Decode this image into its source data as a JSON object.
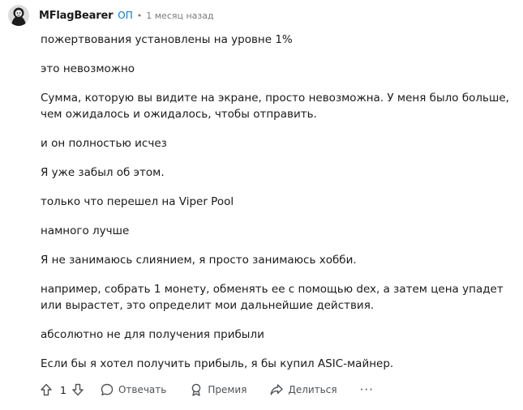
{
  "comment": {
    "author": "MFlagBearer",
    "op_badge": "ОП",
    "separator": "•",
    "timestamp": "1 месяц назад",
    "paragraphs": [
      "пожертвования установлены на уровне 1%",
      "это невозможно",
      "Сумма, которую вы видите на экране, просто невозможна. У меня было больше, чем ожидалось и ожидалось, чтобы отправить.",
      "и он полностью исчез",
      "Я уже забыл об этом.",
      "только что перешел на Viper Pool",
      "намного лучше",
      "Я не занимаюсь слиянием, я просто занимаюсь хобби.",
      "например, собрать 1 монету, обменять ее с помощью dex, а затем цена упадет или вырастет, это определит мои дальнейшие действия.",
      "абсолютно не для получения прибыли",
      "Если бы я хотел получить прибыль, я бы купил ASIC-майнер."
    ]
  },
  "actions": {
    "upvote_icon": "arrow-up-icon",
    "vote_count": "1",
    "downvote_icon": "arrow-down-icon",
    "reply_icon": "comment-bubble-icon",
    "reply_label": "Отвечать",
    "award_icon": "award-icon",
    "award_label": "Премия",
    "share_icon": "share-arrow-icon",
    "share_label": "Делиться",
    "more_label": "···"
  },
  "colors": {
    "op_badge": "#0079d3",
    "meta_text": "#787c7e",
    "body_text": "#1a1a1b",
    "action_text": "#4f5357"
  }
}
